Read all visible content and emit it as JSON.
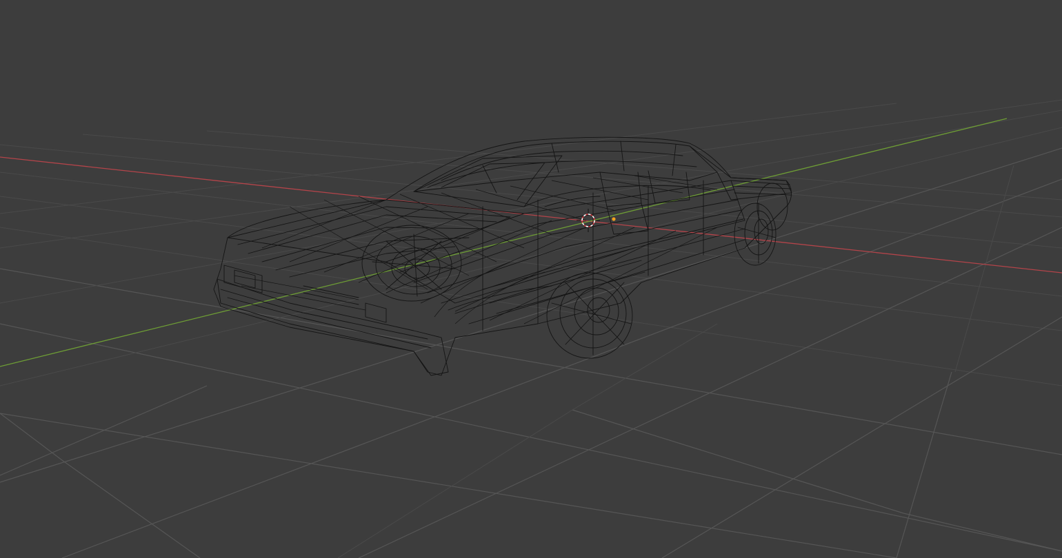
{
  "viewport": {
    "background_color": "#3d3d3d",
    "shading_mode": "wireframe",
    "object": "car"
  },
  "axes": {
    "x_axis_color": "#b4444a",
    "y_axis_color": "#6e9e35"
  },
  "grid": {
    "visible": true,
    "line_color": "#4a4a4a"
  },
  "wireframe": {
    "color": "#141414"
  },
  "cursor_3d": {
    "icon": "3d-cursor-icon",
    "color_outer": "#ffffff",
    "color_inner": "#d2353b"
  },
  "object_origin": {
    "icon": "origin-point-icon",
    "color": "#f0a020"
  }
}
